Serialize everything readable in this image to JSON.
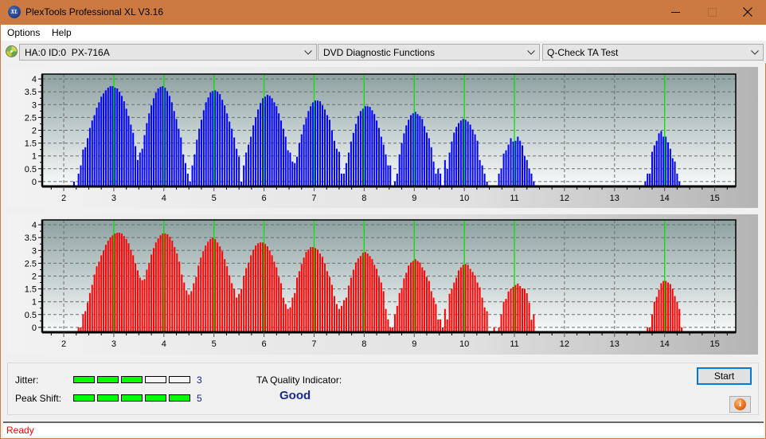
{
  "window": {
    "title": "PlexTools Professional XL V3.16",
    "logo_text": "XL",
    "title_bar_color": "#cc7a42"
  },
  "menu": {
    "items": [
      "Options",
      "Help"
    ]
  },
  "toolbar": {
    "drive_select": "HA:0 ID:0  PX-716A",
    "function_select": "DVD Diagnostic Functions",
    "test_select": "Q-Check TA Test"
  },
  "results": {
    "jitter": {
      "label": "Jitter:",
      "value": "3",
      "level": 3,
      "max": 5
    },
    "peak_shift": {
      "label": "Peak Shift:",
      "value": "5",
      "level": 5,
      "max": 5
    },
    "ta_quality": {
      "label": "TA Quality Indicator:",
      "value": "Good"
    },
    "start_label": "Start",
    "info_glyph": "i",
    "meter_on_color": "#00ff00"
  },
  "status": {
    "text": "Ready",
    "color": "#ff0000"
  },
  "chart_data": [
    {
      "type": "bar",
      "bar_color": "#0000ff",
      "xlim": [
        1.57,
        15.42
      ],
      "ylim": [
        -0.19,
        4.19
      ],
      "xticks": [
        2,
        3,
        4,
        5,
        6,
        7,
        8,
        9,
        10,
        11,
        12,
        13,
        14,
        15
      ],
      "xtick_labels": [
        "2",
        "3",
        "4",
        "5",
        "6",
        "7",
        "8",
        "9",
        "10",
        "11",
        "12",
        "13",
        "14",
        "15"
      ],
      "yticks": [
        0,
        0.5,
        1,
        1.5,
        2,
        2.5,
        3,
        3.5,
        4
      ],
      "ytick_labels": [
        "0",
        "0.5",
        "1",
        "1.5",
        "2",
        "2.5",
        "3",
        "3.5",
        "4"
      ],
      "grid": true,
      "reference_lines": [
        3,
        4,
        5,
        6,
        7,
        8,
        9,
        10,
        11,
        14
      ],
      "reference_color": "#00e600",
      "intervals": [
        {
          "from": 2,
          "to": 3,
          "values": [
            null,
            null,
            null,
            null,
            0.0,
            null,
            0.31,
            0.63,
            1.25,
            1.34,
            1.69,
            2.09,
            2.38,
            2.59,
            2.88,
            3.09,
            3.31,
            3.44,
            3.56,
            3.66,
            3.72,
            3.72
          ]
        },
        {
          "from": 3,
          "to": 4,
          "values": [
            3.66,
            3.63,
            3.5,
            3.34,
            3.13,
            2.84,
            2.56,
            2.22,
            1.9,
            1.38,
            0.84,
            1.13,
            1.28,
            1.81,
            2.28,
            2.66,
            2.97,
            3.25,
            3.47,
            3.63,
            3.69,
            3.72
          ]
        },
        {
          "from": 4,
          "to": 5,
          "values": [
            3.66,
            3.53,
            3.34,
            3.09,
            2.75,
            2.44,
            2.06,
            1.72,
            1.06,
            0.72,
            0.31,
            0.0,
            0.63,
            1.06,
            1.63,
            2.06,
            2.41,
            2.78,
            3.09,
            3.28,
            3.47,
            3.53
          ]
        },
        {
          "from": 5,
          "to": 6,
          "values": [
            3.56,
            3.5,
            3.41,
            3.19,
            2.97,
            2.66,
            2.34,
            2.06,
            1.72,
            1.28,
            0.97,
            0.0,
            0.63,
            1.13,
            1.44,
            1.75,
            2.19,
            2.5,
            2.81,
            3.06,
            3.25
          ]
        },
        {
          "from": 6,
          "to": 7,
          "values": [
            3.31,
            3.38,
            3.34,
            3.25,
            3.09,
            2.94,
            2.66,
            2.38,
            2.06,
            1.75,
            1.22,
            1.13,
            0.78,
            0.72,
            0.97,
            1.5,
            1.84,
            2.22,
            2.47,
            2.75,
            2.94,
            3.09
          ]
        },
        {
          "from": 7,
          "to": 8,
          "values": [
            3.16,
            3.16,
            3.13,
            2.97,
            2.81,
            2.59,
            2.41,
            2.0,
            1.59,
            1.28,
            1.16,
            0.31,
            0.31,
            0.72,
            1.13,
            1.56,
            1.9,
            2.25,
            2.56,
            2.75,
            2.84
          ]
        },
        {
          "from": 8,
          "to": 9,
          "values": [
            2.94,
            2.94,
            2.91,
            2.78,
            2.63,
            2.38,
            2.09,
            1.75,
            1.44,
            1.06,
            0.63,
            0.63,
            null,
            0.0,
            0.31,
            1.06,
            1.5,
            1.88,
            2.19,
            2.41,
            2.59,
            2.66
          ]
        },
        {
          "from": 9,
          "to": 10,
          "values": [
            2.72,
            2.63,
            2.56,
            2.44,
            2.16,
            1.91,
            1.69,
            1.34,
            0.78,
            0.31,
            0.5,
            0.31,
            null,
            0.84,
            0.5,
            1.13,
            1.56,
            1.91,
            2.13,
            2.28,
            2.38,
            2.44
          ]
        },
        {
          "from": 10,
          "to": 11,
          "values": [
            2.41,
            2.34,
            2.22,
            2.03,
            1.84,
            1.59,
            0.84,
            0.63,
            0.31,
            0.0,
            null,
            null,
            null,
            null,
            0.31,
            0.5,
            1.09,
            1.22,
            1.44,
            1.69,
            1.56
          ]
        },
        {
          "from": 11,
          "to": 12,
          "bins": 22,
          "values": [
            1.59,
            1.75,
            1.59,
            1.41,
            1.0,
            0.84,
            0.5,
            0.31,
            0.0
          ]
        },
        {
          "from": 13,
          "to": 14,
          "values": [
            null,
            null,
            null,
            null,
            null,
            null,
            null,
            null,
            null,
            null,
            null,
            null,
            null,
            0.0,
            0.31,
            0.31,
            1.16,
            1.41,
            1.59,
            1.88,
            1.97,
            1.75
          ]
        },
        {
          "from": 14,
          "to": 15,
          "bins": 22,
          "values": [
            1.75,
            1.53,
            1.28,
            0.91,
            0.78,
            0.31,
            0.0
          ]
        }
      ]
    },
    {
      "type": "bar",
      "bar_color": "#ff0000",
      "xlim": [
        1.57,
        15.42
      ],
      "ylim": [
        -0.19,
        4.19
      ],
      "xticks": [
        2,
        3,
        4,
        5,
        6,
        7,
        8,
        9,
        10,
        11,
        12,
        13,
        14,
        15
      ],
      "xtick_labels": [
        "2",
        "3",
        "4",
        "5",
        "6",
        "7",
        "8",
        "9",
        "10",
        "11",
        "12",
        "13",
        "14",
        "15"
      ],
      "yticks": [
        0,
        0.5,
        1,
        1.5,
        2,
        2.5,
        3,
        3.5,
        4
      ],
      "ytick_labels": [
        "0",
        "0.5",
        "1",
        "1.5",
        "2",
        "2.5",
        "3",
        "3.5",
        "4"
      ],
      "grid": true,
      "reference_lines": [
        3,
        4,
        5,
        6,
        7,
        8,
        9,
        10,
        11,
        14
      ],
      "reference_color": "#00e600",
      "intervals": [
        {
          "from": 2,
          "to": 3,
          "values": [
            null,
            null,
            null,
            null,
            null,
            null,
            0.0,
            0.0,
            0.5,
            0.63,
            0.97,
            1.34,
            1.66,
            2.06,
            2.38,
            2.56,
            2.81,
            3.0,
            3.22,
            3.38,
            3.5,
            3.59
          ]
        },
        {
          "from": 3,
          "to": 4,
          "values": [
            3.66,
            3.69,
            3.69,
            3.66,
            3.56,
            3.44,
            3.28,
            3.03,
            2.81,
            2.5,
            2.22,
            1.94,
            1.84,
            1.88,
            2.25,
            2.5,
            2.84,
            3.09,
            3.31,
            3.47,
            3.59,
            3.66
          ]
        },
        {
          "from": 4,
          "to": 5,
          "values": [
            3.66,
            3.63,
            3.53,
            3.38,
            3.13,
            2.88,
            2.56,
            2.06,
            1.75,
            1.44,
            1.28,
            1.41,
            1.72,
            1.97,
            2.41,
            2.72,
            2.97,
            3.19,
            3.34,
            3.44,
            3.5
          ]
        },
        {
          "from": 5,
          "to": 6,
          "values": [
            3.44,
            3.31,
            3.16,
            2.97,
            2.66,
            2.38,
            2.03,
            1.72,
            1.5,
            1.16,
            1.31,
            1.5,
            2.0,
            2.31,
            2.53,
            2.81,
            3.03,
            3.19,
            3.28,
            3.31,
            3.31
          ]
        },
        {
          "from": 6,
          "to": 7,
          "values": [
            3.25,
            3.16,
            3.0,
            2.81,
            2.56,
            2.34,
            1.97,
            1.72,
            1.16,
            0.91,
            0.72,
            0.78,
            1.16,
            1.34,
            1.94,
            2.19,
            2.47,
            2.72,
            2.94,
            3.03,
            3.13,
            3.13
          ]
        },
        {
          "from": 7,
          "to": 8,
          "values": [
            3.09,
            3.03,
            2.88,
            2.75,
            2.5,
            2.19,
            1.97,
            1.66,
            1.22,
            0.91,
            0.72,
            0.84,
            1.06,
            1.16,
            1.63,
            1.94,
            2.25,
            2.53,
            2.69,
            2.78,
            2.91
          ]
        },
        {
          "from": 8,
          "to": 9,
          "values": [
            2.94,
            2.88,
            2.78,
            2.66,
            2.44,
            2.28,
            1.97,
            1.75,
            1.41,
            0.72,
            0.31,
            0.0,
            0.0,
            0.5,
            0.84,
            1.34,
            1.53,
            1.91,
            2.13,
            2.41,
            2.53,
            2.59
          ]
        },
        {
          "from": 9,
          "to": 10,
          "values": [
            2.66,
            2.59,
            2.53,
            2.34,
            2.22,
            1.97,
            1.81,
            1.41,
            1.16,
            0.91,
            0.31,
            0.31,
            0.0,
            0.72,
            0.31,
            1.31,
            1.5,
            1.75,
            1.94,
            2.22,
            2.34,
            2.44
          ]
        },
        {
          "from": 10,
          "to": 11,
          "values": [
            2.47,
            2.44,
            2.28,
            2.16,
            2.03,
            1.75,
            1.56,
            1.16,
            0.78,
            0.63,
            null,
            null,
            0.0,
            null,
            0.0,
            0.5,
            1.0,
            1.11,
            1.4,
            1.5,
            1.58
          ]
        },
        {
          "from": 11,
          "to": 12,
          "bins": 22,
          "values": [
            1.65,
            1.71,
            1.61,
            1.52,
            1.5,
            1.33,
            0.96,
            0.3,
            0.5
          ]
        },
        {
          "from": 13,
          "to": 14,
          "values": [
            null,
            null,
            null,
            null,
            null,
            null,
            null,
            null,
            null,
            null,
            null,
            null,
            null,
            null,
            0.0,
            0.0,
            0.5,
            1.0,
            1.19,
            1.47,
            1.72,
            1.81
          ]
        },
        {
          "from": 14,
          "to": 15,
          "bins": 22,
          "values": [
            1.81,
            1.75,
            1.69,
            1.5,
            1.22,
            1.0,
            0.72,
            0.0
          ]
        }
      ]
    }
  ]
}
